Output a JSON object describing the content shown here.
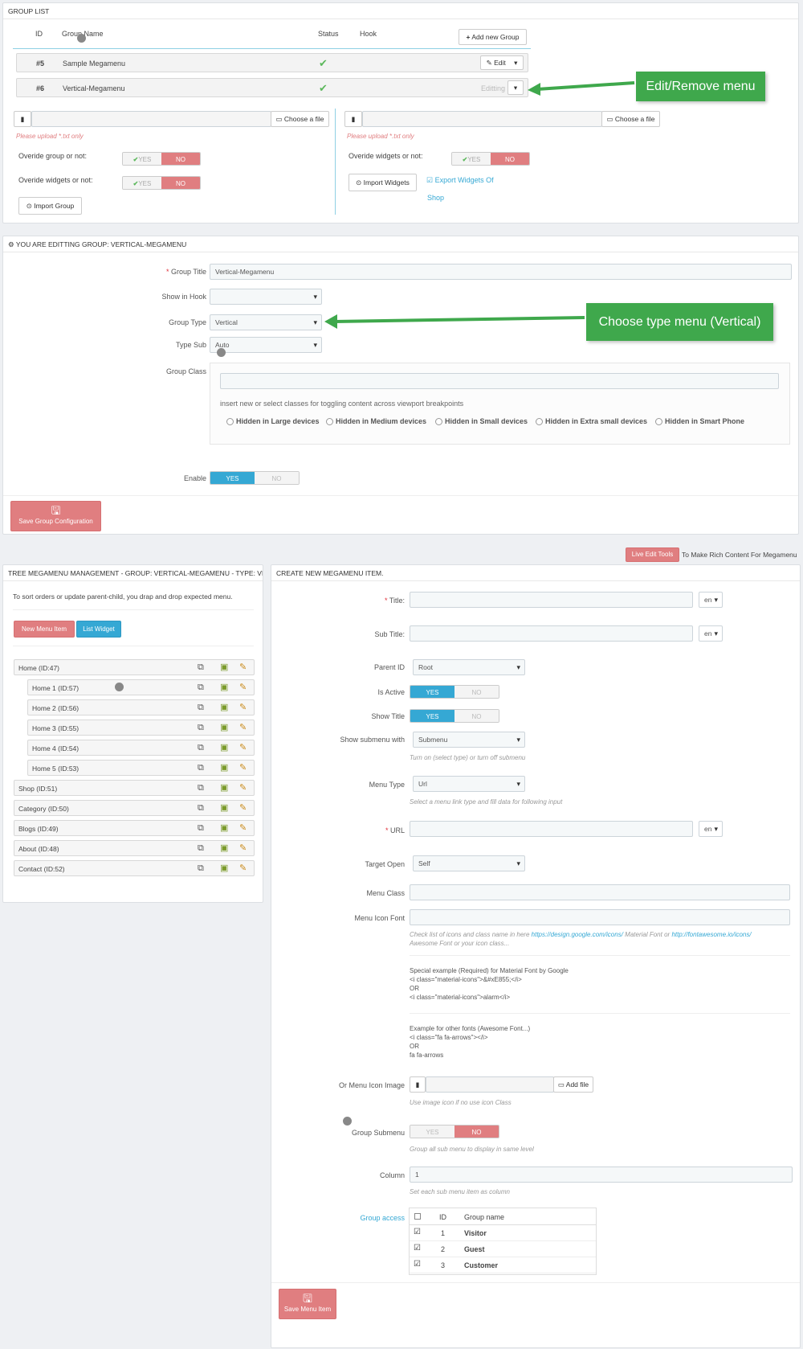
{
  "colors": {
    "accent_blue": "#35a8d4",
    "danger": "#e07e80",
    "green": "#3fa84c",
    "check": "#5cb85c"
  },
  "group_list": {
    "title": "GROUP LIST",
    "columns": [
      "ID",
      "Group Name",
      "Status",
      "Hook"
    ],
    "add_button": "Add new Group",
    "rows": [
      {
        "id": "#5",
        "name": "Sample Megamenu",
        "action": "Edit"
      },
      {
        "id": "#6",
        "name": "Vertical-Megamenu",
        "action": "Editting"
      }
    ],
    "choose_file": "Choose a file",
    "upload_hint": "Please upload *.txt only",
    "override_group": "Overide group or not:",
    "override_widgets": "Overide widgets or not:",
    "yes": "YES",
    "no": "NO",
    "import_group": "Import Group",
    "import_widgets": "Import Widgets",
    "export_widgets_a": "Export Widgets Of",
    "export_widgets_b": "Shop"
  },
  "callouts": {
    "edit_remove": "Edit/Remove menu",
    "choose_type": "Choose type menu (Vertical)"
  },
  "edit_group": {
    "title": "YOU ARE EDITTING GROUP: VERTICAL-MEGAMENU",
    "group_title_label": "Group Title",
    "group_title_value": "Vertical-Megamenu",
    "show_in_hook_label": "Show in Hook",
    "group_type_label": "Group Type",
    "group_type_value": "Vertical",
    "type_sub_label": "Type Sub",
    "type_sub_value": "Auto",
    "group_class_label": "Group Class",
    "class_help": "insert new or select classes for toggling content across viewport breakpoints",
    "hidden_options": [
      "Hidden in Large devices",
      "Hidden in Medium devices",
      "Hidden in Small devices",
      "Hidden in Extra small devices",
      "Hidden in Smart Phone"
    ],
    "enable_label": "Enable",
    "save_button": "Save Group Configuration"
  },
  "live_edit": {
    "button": "Live Edit Tools",
    "text": "To Make Rich Content For Megamenu"
  },
  "tree": {
    "title": "TREE MEGAMENU MANAGEMENT - GROUP: VERTICAL-MEGAMENU - TYPE: VERTICAL",
    "help": "To sort orders or update parent-child, you drap and drop expected menu.",
    "new_item": "New Menu Item",
    "list_widget": "List Widget",
    "items": [
      {
        "label": "Home (ID:47)",
        "child": false
      },
      {
        "label": "Home 1 (ID:57)",
        "child": true
      },
      {
        "label": "Home 2 (ID:56)",
        "child": true
      },
      {
        "label": "Home 3 (ID:55)",
        "child": true
      },
      {
        "label": "Home 4 (ID:54)",
        "child": true
      },
      {
        "label": "Home 5 (ID:53)",
        "child": true
      },
      {
        "label": "Shop (ID:51)",
        "child": false
      },
      {
        "label": "Category (ID:50)",
        "child": false
      },
      {
        "label": "Blogs (ID:49)",
        "child": false
      },
      {
        "label": "About (ID:48)",
        "child": false
      },
      {
        "label": "Contact (ID:52)",
        "child": false
      }
    ]
  },
  "create": {
    "title": "CREATE NEW MEGAMENU ITEM.",
    "title_label": "Title:",
    "subtitle_label": "Sub Title:",
    "lang": "en",
    "parent_label": "Parent ID",
    "parent_value": "Root",
    "active_label": "Is Active",
    "show_title_label": "Show Title",
    "show_sub_label": "Show submenu with",
    "show_sub_value": "Submenu",
    "show_sub_help": "Turn on (select type) or turn off submenu",
    "menu_type_label": "Menu Type",
    "menu_type_value": "Url",
    "menu_type_help": "Select a menu link type and fill data for following input",
    "url_label": "URL",
    "target_label": "Target Open",
    "target_value": "Self",
    "menu_class_label": "Menu Class",
    "icon_font_label": "Menu Icon Font",
    "icon_help_1": "Check list of icons and class name in here",
    "icon_link_1": "https://design.google.com/icons/",
    "icon_help_2": "Material Font or",
    "icon_link_2": "http://fontawesome.io/icons/",
    "icon_help_3": "Awesome Font or your icon class...",
    "special_1": "Special example (Required) for Material Font by Google",
    "special_2": "<i class=\"material-icons\">&#xE855;</i>",
    "special_3": "OR",
    "special_4": "<i class=\"material-icons\">alarm</i>",
    "other_1": "Example for other fonts (Awesome Font...)",
    "other_2": "<i class=\"fa fa-arrows\"></i>",
    "other_3": "OR",
    "other_4": "fa fa-arrows",
    "icon_image_label": "Or Menu Icon Image",
    "add_file": "Add file",
    "icon_image_help": "Use image icon if no use icon Class",
    "group_sub_label": "Group Submenu",
    "group_sub_help": "Group all sub menu to display in same level",
    "column_label": "Column",
    "column_value": "1",
    "column_help": "Set each sub menu item as column",
    "access_label": "Group access",
    "access_cols": [
      "ID",
      "Group name"
    ],
    "access_rows": [
      {
        "id": "1",
        "name": "Visitor"
      },
      {
        "id": "2",
        "name": "Guest"
      },
      {
        "id": "3",
        "name": "Customer"
      }
    ],
    "save_button": "Save Menu Item"
  }
}
